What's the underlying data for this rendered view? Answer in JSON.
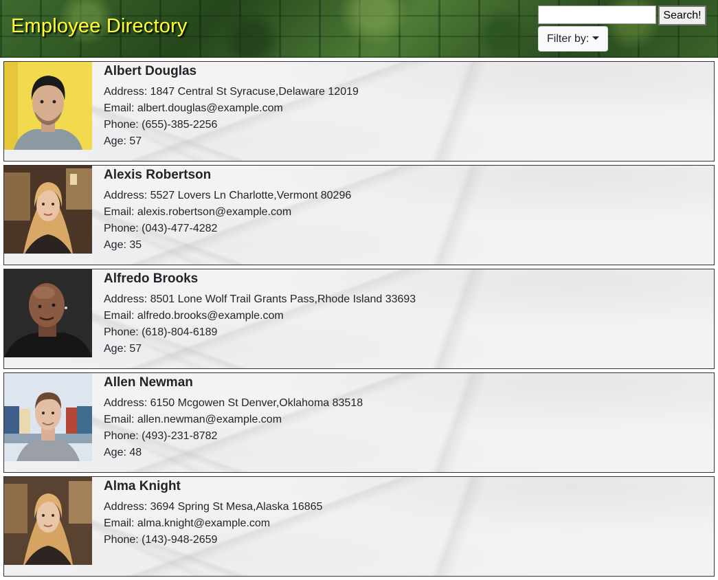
{
  "header": {
    "title": "Employee Directory",
    "search_placeholder": "",
    "search_button": "Search!",
    "filter_label": "Filter by:"
  },
  "labels": {
    "address": "Address: ",
    "email": "Email: ",
    "phone": "Phone: ",
    "age": "Age: "
  },
  "employees": [
    {
      "name": "Albert Douglas",
      "address": "1847 Central St Syracuse,Delaware 12019",
      "email": "albert.douglas@example.com",
      "phone": "(655)-385-2256",
      "age": "57"
    },
    {
      "name": "Alexis Robertson",
      "address": "5527 Lovers Ln Charlotte,Vermont 80296",
      "email": "alexis.robertson@example.com",
      "phone": "(043)-477-4282",
      "age": "35"
    },
    {
      "name": "Alfredo Brooks",
      "address": "8501 Lone Wolf Trail Grants Pass,Rhode Island 33693",
      "email": "alfredo.brooks@example.com",
      "phone": "(618)-804-6189",
      "age": "57"
    },
    {
      "name": "Allen Newman",
      "address": "6150 Mcgowen St Denver,Oklahoma 83518",
      "email": "allen.newman@example.com",
      "phone": "(493)-231-8782",
      "age": "48"
    },
    {
      "name": "Alma Knight",
      "address": "3694 Spring St Mesa,Alaska 16865",
      "email": "alma.knight@example.com",
      "phone": "(143)-948-2659",
      "age": ""
    }
  ]
}
